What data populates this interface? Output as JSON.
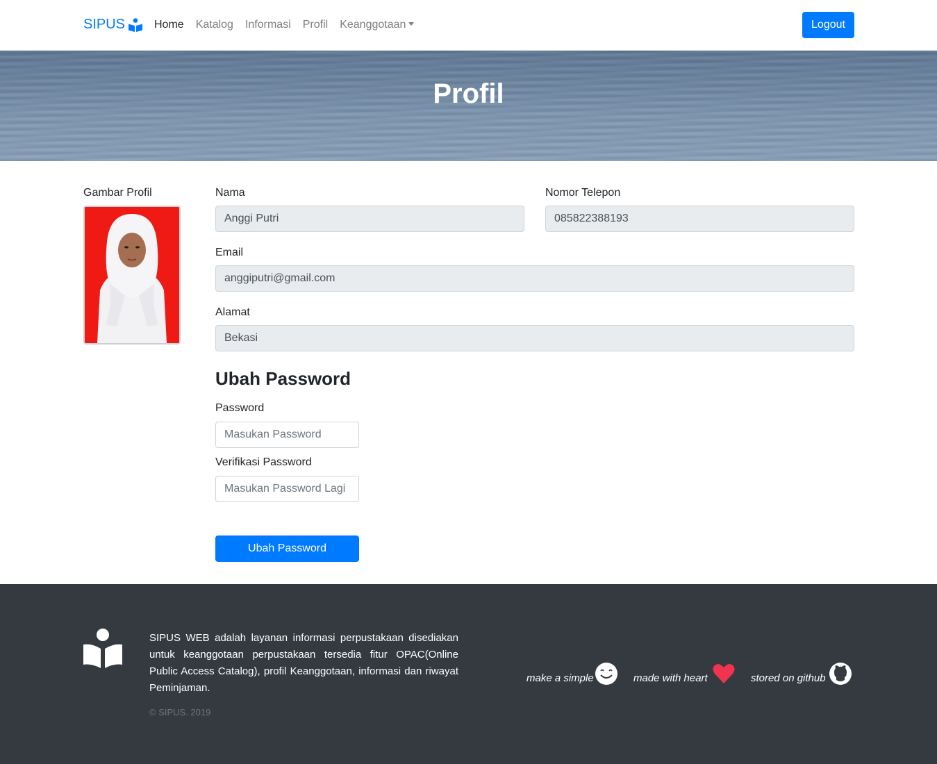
{
  "nav": {
    "brand": "SIPUS",
    "links": [
      "Home",
      "Katalog",
      "Informasi",
      "Profil",
      "Keanggotaan"
    ],
    "logout": "Logout"
  },
  "hero": {
    "title": "Profil"
  },
  "profile": {
    "photo_label": "Gambar Profil",
    "nama_label": "Nama",
    "nama_value": "Anggi Putri",
    "telepon_label": "Nomor Telepon",
    "telepon_value": "085822388193",
    "email_label": "Email",
    "email_value": "anggiputri@gmail.com",
    "alamat_label": "Alamat",
    "alamat_value": "Bekasi"
  },
  "password": {
    "title": "Ubah Password",
    "password_label": "Password",
    "password_placeholder": "Masukan Password",
    "verify_label": "Verifikasi Password",
    "verify_placeholder": "Masukan Password Lagi",
    "submit": "Ubah Password"
  },
  "footer": {
    "description": "SIPUS WEB adalah layanan informasi perpustakaan disediakan untuk keanggotaan perpustakaan tersedia fitur OPAC(Online Public Access Catalog), profil Keanggotaan, informasi dan riwayat Peminjaman.",
    "copyright": "© SIPUS. 2019",
    "tag_simple": "make a simple",
    "tag_heart": "made with heart",
    "tag_github": "stored on github"
  },
  "colors": {
    "primary": "#007bff",
    "footer_bg": "#343a40",
    "heart": "#f0344f"
  }
}
